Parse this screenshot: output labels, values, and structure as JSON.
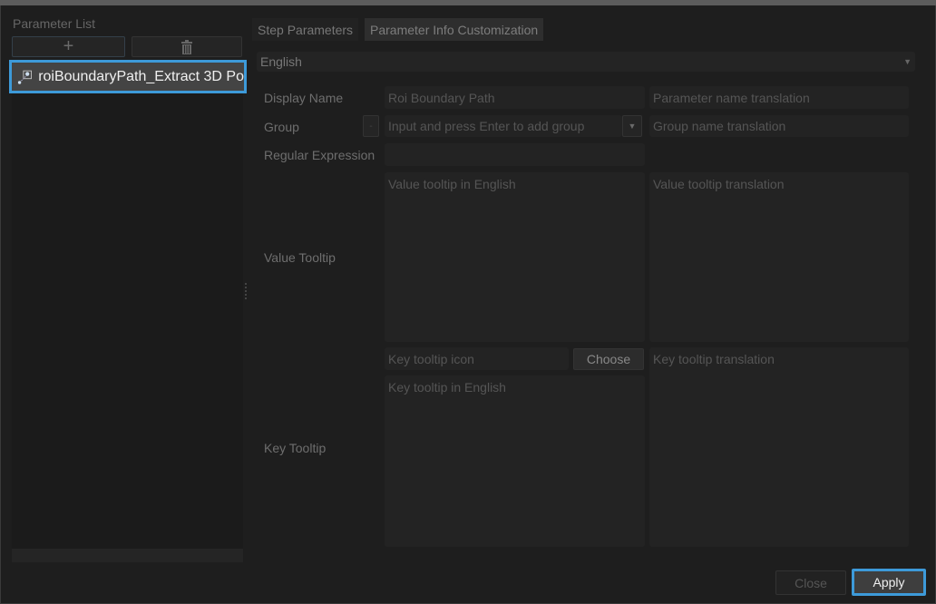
{
  "left_panel": {
    "title": "Parameter List",
    "items": [
      {
        "label": "roiBoundaryPath_Extract 3D Po"
      }
    ]
  },
  "tabs": [
    {
      "label": "Step Parameters"
    },
    {
      "label": "Parameter Info Customization",
      "active": true
    }
  ],
  "language": {
    "selected": "English"
  },
  "form": {
    "display_name": {
      "label": "Display Name",
      "value": "Roi Boundary Path",
      "translation_placeholder": "Parameter name translation"
    },
    "group": {
      "label": "Group",
      "minus": "-",
      "placeholder": "Input and press Enter to add group",
      "translation_placeholder": "Group name translation"
    },
    "regex": {
      "label": "Regular Expression"
    },
    "value_tooltip": {
      "label": "Value Tooltip",
      "placeholder": "Value tooltip in English",
      "translation_placeholder": "Value tooltip translation"
    },
    "key_tooltip": {
      "label": "Key Tooltip",
      "icon_placeholder": "Key tooltip icon",
      "choose": "Choose",
      "placeholder": "Key tooltip in English",
      "translation_placeholder": "Key tooltip translation"
    }
  },
  "footer": {
    "close": "Close",
    "apply": "Apply"
  },
  "colors": {
    "accent": "#3d9ad9"
  }
}
